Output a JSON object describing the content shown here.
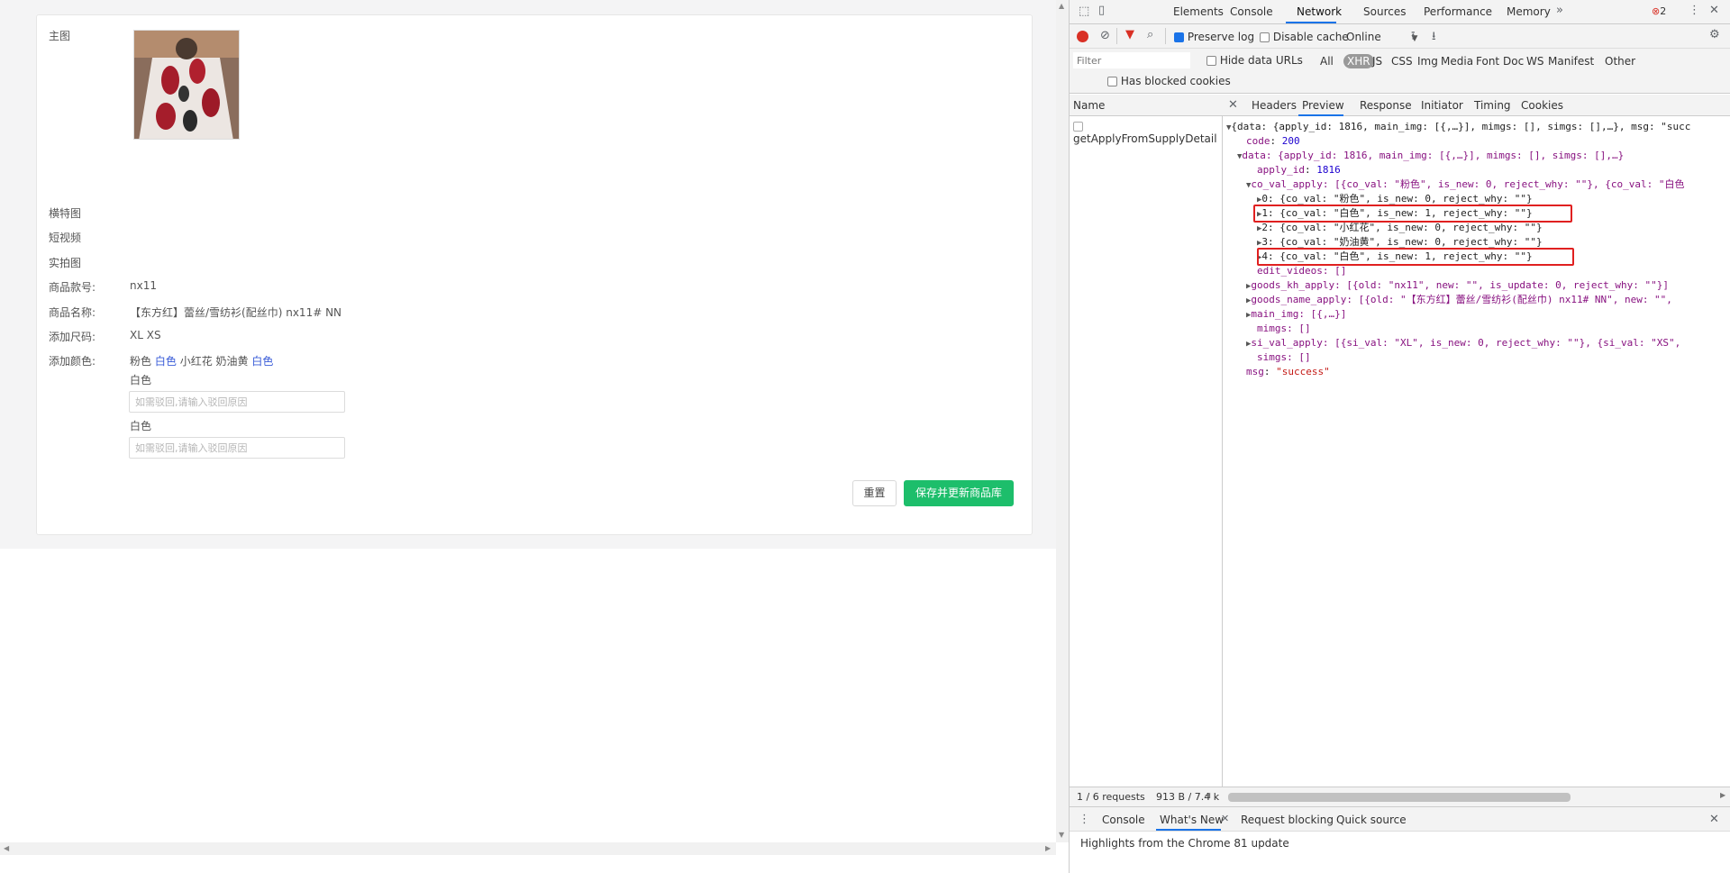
{
  "form": {
    "labels": {
      "main_img": "主图",
      "banner_img": "横特图",
      "short_video": "短视频",
      "real_photo": "实拍图",
      "style_no": "商品款号:",
      "goods_name": "商品名称:",
      "add_size": "添加尺码:",
      "add_color": "添加颜色:"
    },
    "style_no_value": "nx11",
    "goods_name_value": "【东方红】蕾丝/雪纺衫(配丝巾) nx11# NN",
    "sizes": "XL XS",
    "colors": [
      {
        "name": "粉色",
        "is_new": false
      },
      {
        "name": "白色",
        "is_new": true
      },
      {
        "name": "小红花",
        "is_new": false
      },
      {
        "name": "奶油黄",
        "is_new": false
      },
      {
        "name": "白色",
        "is_new": true
      }
    ],
    "reject_fields": [
      {
        "label": "白色",
        "placeholder": "如需驳回,请输入驳回原因"
      },
      {
        "label": "白色",
        "placeholder": "如需驳回,请输入驳回原因"
      }
    ],
    "reset_label": "重置",
    "save_label": "保存并更新商品库"
  },
  "devtools": {
    "tabs": [
      "Elements",
      "Console",
      "Network",
      "Sources",
      "Performance",
      "Memory"
    ],
    "active_tab": "Network",
    "error_count": "2",
    "toolbar": {
      "preserve_log": "Preserve log",
      "disable_cache": "Disable cache",
      "throttle": "Online"
    },
    "filter_placeholder": "Filter",
    "hide_data_urls": "Hide data URLs",
    "type_filters": [
      "All",
      "XHR",
      "JS",
      "CSS",
      "Img",
      "Media",
      "Font",
      "Doc",
      "WS",
      "Manifest",
      "Other"
    ],
    "has_blocked_cookies": "Has blocked cookies",
    "name_header": "Name",
    "request_name": "getApplyFromSupplyDetail",
    "detail_tabs": [
      "Headers",
      "Preview",
      "Response",
      "Initiator",
      "Timing",
      "Cookies"
    ],
    "active_detail_tab": "Preview",
    "status_requests": "1 / 6 requests",
    "status_size": "913 B / 7.4 k",
    "drawer_tabs": [
      "Console",
      "What's New",
      "Request blocking",
      "Quick source"
    ],
    "drawer_message": "Highlights from the Chrome 81 update",
    "json_lines": {
      "l0": "{data: {apply_id: 1816, main_img: [{,…}], mimgs: [], simgs: [],…}, msg: \"succ",
      "l1_key": "code",
      "l1_val": "200",
      "l2": "data: {apply_id: 1816, main_img: [{,…}], mimgs: [], simgs: [],…}",
      "l3_key": "apply_id",
      "l3_val": "1816",
      "l4": "co_val_apply: [{co_val: \"粉色\", is_new: 0, reject_why: \"\"}, {co_val: \"白色",
      "l5": "0: {co_val: \"粉色\", is_new: 0, reject_why: \"\"}",
      "l6": "1: {co_val: \"白色\", is_new: 1, reject_why: \"\"}",
      "l7": "2: {co_val: \"小红花\", is_new: 0, reject_why: \"\"}",
      "l8": "3: {co_val: \"奶油黄\", is_new: 0, reject_why: \"\"}",
      "l9": "4: {co_val: \"白色\", is_new: 1, reject_why: \"\"}",
      "l10": "edit_videos: []",
      "l11": "goods_kh_apply: [{old: \"nx11\", new: \"\", is_update: 0, reject_why: \"\"}]",
      "l12": "goods_name_apply: [{old: \"【东方红】蕾丝/雪纺衫(配丝巾) nx11# NN\", new: \"\",",
      "l13": "main_img: [{,…}]",
      "l14": "mimgs: []",
      "l15": "si_val_apply: [{si_val: \"XL\", is_new: 0, reject_why: \"\"}, {si_val: \"XS\",",
      "l16": "simgs: []",
      "l17_key": "msg",
      "l17_val": "\"success\""
    }
  },
  "colors": {
    "save_button": "#1dbe6b",
    "highlight_box": "#e02020",
    "new_color_text": "#3a5cd8"
  }
}
